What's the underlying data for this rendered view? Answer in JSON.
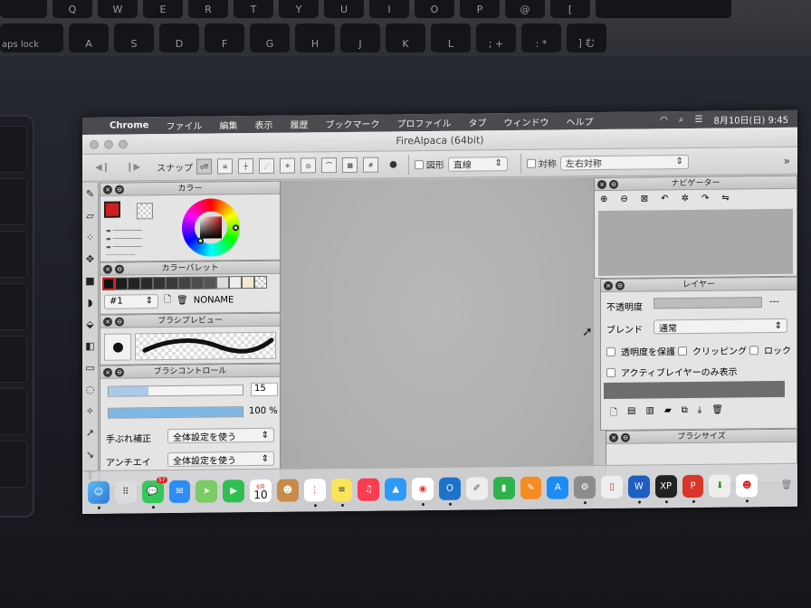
{
  "keyboard": {
    "row1": [
      "",
      "Q",
      "W",
      "E",
      "R",
      "T",
      "Y",
      "U",
      "I",
      "O",
      "P",
      "@",
      "[",
      ""
    ],
    "row2_caps": "aps lock",
    "row2": [
      "A",
      "S",
      "D",
      "F",
      "G",
      "H",
      "J",
      "K",
      "L",
      "; +",
      ": *",
      "] む"
    ]
  },
  "menubar": {
    "apple_icon": "apple-icon",
    "items": [
      "Chrome",
      "ファイル",
      "編集",
      "表示",
      "履歴",
      "ブックマーク",
      "プロファイル",
      "タブ",
      "ウィンドウ",
      "ヘルプ"
    ],
    "date_time": "8月10日(日) 9:45"
  },
  "window": {
    "title": "FireAlpaca (64bit)"
  },
  "toolbar": {
    "snap_label": "スナップ",
    "snap_off": "off",
    "figure_label": "図形",
    "figure_value": "直線",
    "symmetry_label": "対称",
    "symmetry_value": "左右対称",
    "more": "»"
  },
  "panels": {
    "color": {
      "title": "カラー"
    },
    "palette": {
      "title": "カラーパレット",
      "index": "#1",
      "name": "NONAME"
    },
    "brush_preview": {
      "title": "ブラシプレビュー"
    },
    "brush_control": {
      "title": "ブラシコントロール",
      "size_value": "15",
      "opacity_value": "100 %",
      "stabilizer_label": "手ぶれ補正",
      "stabilizer_value": "全体設定を使う",
      "antialias_label": "アンチエイ",
      "antialias_value": "全体設定を使う"
    },
    "navigator": {
      "title": "ナビゲーター"
    },
    "layer": {
      "title": "レイヤー",
      "opacity_label": "不透明度",
      "opacity_value": "---",
      "blend_label": "ブレンド",
      "blend_value": "通常",
      "protect_alpha": "透明度を保護",
      "clipping": "クリッピング",
      "lock": "ロック",
      "active_only": "アクティブレイヤーのみ表示"
    },
    "brush_size": {
      "title": "ブラシサイズ"
    }
  },
  "dock": {
    "calendar_month": "8月",
    "calendar_day": "10",
    "messages_badge": "57"
  },
  "colors": {
    "menubar_bg": "#4a4a4f",
    "panel_bg": "#e4e4e4",
    "canvas_bg": "#b2b2b2",
    "primary_color": "#d01f1f"
  }
}
